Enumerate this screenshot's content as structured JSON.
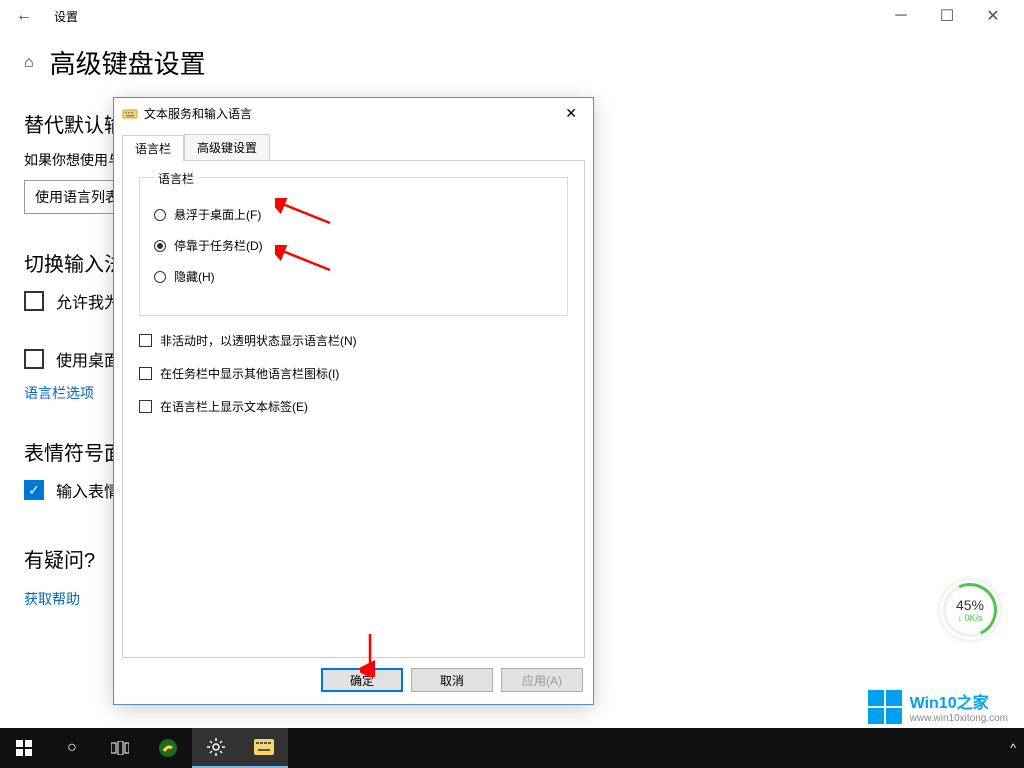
{
  "titlebar": {
    "title": "设置"
  },
  "page": {
    "title": "高级键盘设置",
    "section1_title": "替代默认输入法",
    "section1_desc": "如果你想使用与语言列表中最靠前的输入法不同的输入法,请在此处选择",
    "button_lang_list": "使用语言列表(推荐)",
    "section2_title": "切换输入法",
    "cb_allow": "允许我为每个应用窗口使用不同的输入法",
    "cb_desktop": "使用桌面语言栏(如果可用)",
    "link_langbar": "语言栏选项",
    "section3_title": "表情符号面板",
    "cb_emoji": "输入表情符号后请勿自动关闭面板",
    "section4_title": "有疑问?",
    "link_help": "获取帮助"
  },
  "dialog": {
    "title": "文本服务和输入语言",
    "tab1": "语言栏",
    "tab2": "高级键设置",
    "legend": "语言栏",
    "radio_float": "悬浮于桌面上(F)",
    "radio_dock": "停靠于任务栏(D)",
    "radio_hide": "隐藏(H)",
    "cb_transparent": "非活动时，以透明状态显示语言栏(N)",
    "cb_other_icons": "在任务栏中显示其他语言栏图标(I)",
    "cb_text_labels": "在语言栏上显示文本标签(E)",
    "btn_ok": "确定",
    "btn_cancel": "取消",
    "btn_apply": "应用(A)"
  },
  "speed": {
    "pct": "45%",
    "rate": "0K/s"
  },
  "brand": {
    "name": "Win10之家",
    "url": "www.win10xitong.com"
  },
  "tray": {
    "chevron": "^"
  }
}
